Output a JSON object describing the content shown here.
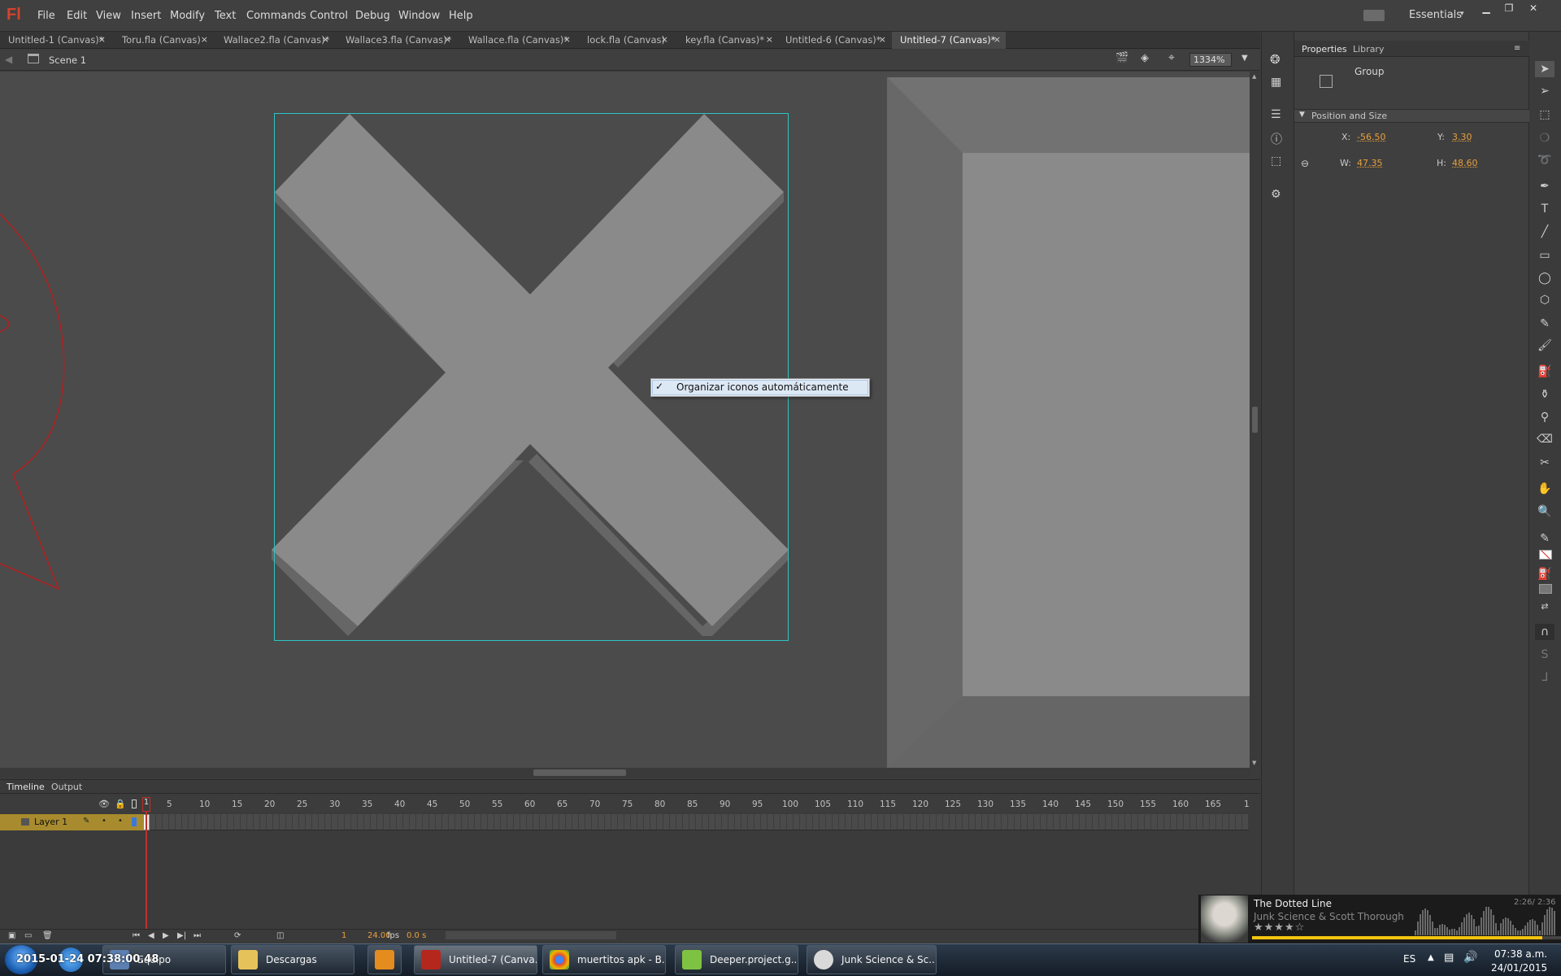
{
  "app": {
    "logo": "Fl",
    "workspace": "Essentials",
    "menu": [
      "File",
      "Edit",
      "View",
      "Insert",
      "Modify",
      "Text",
      "Commands",
      "Control",
      "Debug",
      "Window",
      "Help"
    ]
  },
  "tabs": [
    {
      "label": "Untitled-1 (Canvas)*",
      "active": false
    },
    {
      "label": "Toru.fla (Canvas)",
      "active": false
    },
    {
      "label": "Wallace2.fla (Canvas)*",
      "active": false
    },
    {
      "label": "Wallace3.fla (Canvas)*",
      "active": false
    },
    {
      "label": "Wallace.fla (Canvas)*",
      "active": false
    },
    {
      "label": "lock.fla (Canvas)",
      "active": false
    },
    {
      "label": "key.fla (Canvas)*",
      "active": false
    },
    {
      "label": "Untitled-6 (Canvas)*",
      "active": false
    },
    {
      "label": "Untitled-7 (Canvas)*",
      "active": true
    }
  ],
  "editbar": {
    "scene": "Scene 1",
    "zoom": "1334%"
  },
  "context_menu": {
    "item": "Organizar iconos automáticamente",
    "checked": true
  },
  "properties": {
    "tabs": [
      "Properties",
      "Library"
    ],
    "object_type": "Group",
    "section": "Position and Size",
    "x_label": "X:",
    "x": "-56.50",
    "y_label": "Y:",
    "y": "3.30",
    "w_label": "W:",
    "w": "47.35",
    "h_label": "H:",
    "h": "48.60"
  },
  "timeline": {
    "tabs": [
      "Timeline",
      "Output"
    ],
    "layer": "Layer 1",
    "frame_numbers": [
      "1",
      "5",
      "10",
      "15",
      "20",
      "25",
      "30",
      "35",
      "40",
      "45",
      "50",
      "55",
      "60",
      "65",
      "70",
      "75",
      "80",
      "85",
      "90",
      "95",
      "100",
      "105",
      "110",
      "115",
      "120",
      "125",
      "130",
      "135",
      "140",
      "145",
      "150",
      "155",
      "160",
      "165",
      "1"
    ],
    "current_frame": "1",
    "fps": "24.00",
    "fps_unit": "fps",
    "elapsed": "0.0 s"
  },
  "music": {
    "title": "The Dotted Line",
    "artist": "Junk Science & Scott Thorough",
    "time": "2:26/ 2:36",
    "rating": "★★★★☆",
    "progress": 0.94
  },
  "taskbar": {
    "buttons": [
      {
        "label": "Equipo",
        "active": false
      },
      {
        "label": "Descargas",
        "active": false
      },
      {
        "label": "",
        "active": false
      },
      {
        "label": "Untitled-7 (Canva...",
        "active": true
      },
      {
        "label": "muertitos apk - B...",
        "active": false
      },
      {
        "label": "Deeper.project.g...",
        "active": false
      },
      {
        "label": "Junk Science & Sc...",
        "active": false
      }
    ],
    "overlay_timestamp": "2015-01-24 07:38:00.48",
    "lang": "ES",
    "time": "07:38 a.m.",
    "date": "24/01/2015"
  },
  "colors": {
    "accent_orange": "#e8a03c",
    "selection_cyan": "#2ec4c4",
    "playhead_red": "#c0302a",
    "layer_gold": "#a88b2e"
  }
}
